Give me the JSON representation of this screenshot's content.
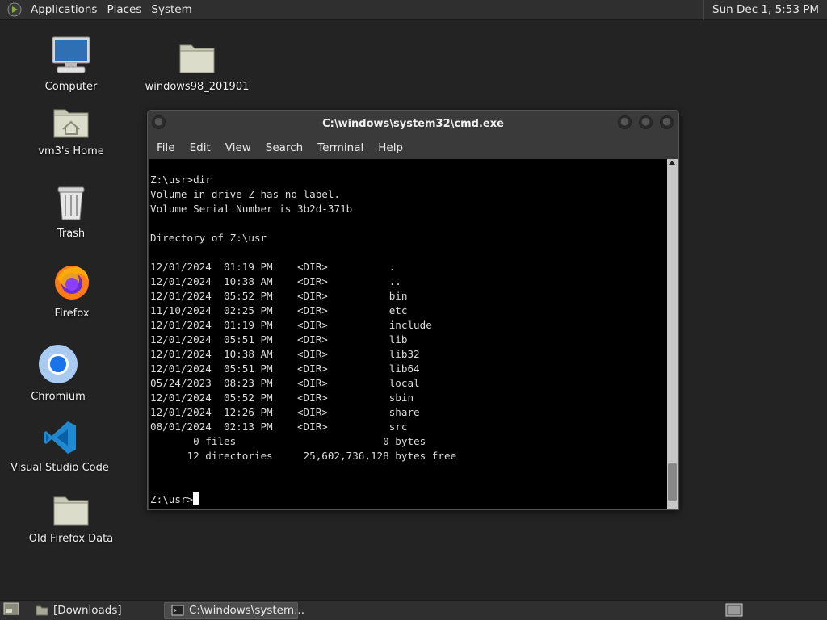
{
  "top_panel": {
    "menus": [
      "Applications",
      "Places",
      "System"
    ],
    "clock": "Sun Dec 1,  5:53 PM"
  },
  "desktop_icons": [
    {
      "label": "Computer",
      "icon": "computer-icon"
    },
    {
      "label": "vm3's Home",
      "icon": "home-folder-icon"
    },
    {
      "label": "Trash",
      "icon": "trash-icon"
    },
    {
      "label": "Firefox",
      "icon": "firefox-icon"
    },
    {
      "label": "Chromium",
      "icon": "chromium-icon"
    },
    {
      "label": "Visual Studio Code",
      "icon": "vscode-icon"
    },
    {
      "label": "Old Firefox Data",
      "icon": "folder-icon"
    },
    {
      "label": "windows98_201901",
      "icon": "folder-icon"
    }
  ],
  "window": {
    "title": "C:\\windows\\system32\\cmd.exe",
    "menu": [
      "File",
      "Edit",
      "View",
      "Search",
      "Terminal",
      "Help"
    ],
    "terminal_text": "Z:\\usr>dir\nVolume in drive Z has no label.\nVolume Serial Number is 3b2d-371b\n\nDirectory of Z:\\usr\n\n12/01/2024  01:19 PM    <DIR>          .\n12/01/2024  10:38 AM    <DIR>          ..\n12/01/2024  05:52 PM    <DIR>          bin\n11/10/2024  02:25 PM    <DIR>          etc\n12/01/2024  01:19 PM    <DIR>          include\n12/01/2024  05:51 PM    <DIR>          lib\n12/01/2024  10:38 AM    <DIR>          lib32\n12/01/2024  05:51 PM    <DIR>          lib64\n05/24/2023  08:23 PM    <DIR>          local\n12/01/2024  05:52 PM    <DIR>          sbin\n12/01/2024  12:26 PM    <DIR>          share\n08/01/2024  02:13 PM    <DIR>          src\n       0 files                        0 bytes\n      12 directories     25,602,736,128 bytes free\n\n\n",
    "prompt": "Z:\\usr>"
  },
  "taskbar": {
    "tasks": [
      "[Downloads]",
      "C:\\windows\\system..."
    ]
  }
}
